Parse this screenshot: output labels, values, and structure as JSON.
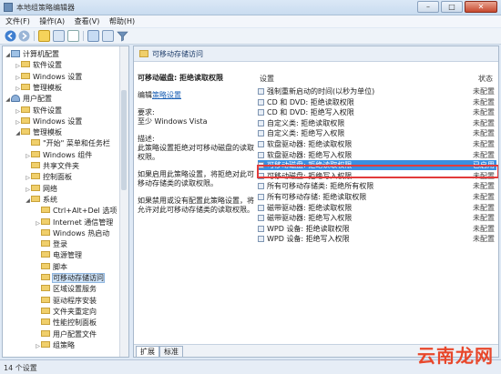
{
  "window": {
    "title": "本地组策略编辑器",
    "buttons": {
      "minimize": "–",
      "maximize": "□",
      "close": "✕"
    }
  },
  "menu": [
    "文件(F)",
    "操作(A)",
    "查看(V)",
    "帮助(H)"
  ],
  "tree": [
    {
      "label": "计算机配置",
      "icon": "computer",
      "level": 0,
      "exp": "◢"
    },
    {
      "label": "软件设置",
      "icon": "folder",
      "level": 1,
      "exp": "▷"
    },
    {
      "label": "Windows 设置",
      "icon": "folder",
      "level": 1,
      "exp": "▷"
    },
    {
      "label": "管理模板",
      "icon": "folder",
      "level": 1,
      "exp": "▷"
    },
    {
      "label": "用户配置",
      "icon": "user",
      "level": 0,
      "exp": "◢"
    },
    {
      "label": "软件设置",
      "icon": "folder",
      "level": 1,
      "exp": "▷"
    },
    {
      "label": "Windows 设置",
      "icon": "folder",
      "level": 1,
      "exp": "▷"
    },
    {
      "label": "管理模板",
      "icon": "folder",
      "level": 1,
      "exp": "◢"
    },
    {
      "label": "\"开始\" 菜单和任务栏",
      "icon": "folder",
      "level": 2,
      "exp": ""
    },
    {
      "label": "Windows 组件",
      "icon": "folder",
      "level": 2,
      "exp": "▷"
    },
    {
      "label": "共享文件夹",
      "icon": "folder",
      "level": 2,
      "exp": ""
    },
    {
      "label": "控制面板",
      "icon": "folder",
      "level": 2,
      "exp": "▷"
    },
    {
      "label": "网络",
      "icon": "folder",
      "level": 2,
      "exp": "▷"
    },
    {
      "label": "系统",
      "icon": "folder",
      "level": 2,
      "exp": "◢"
    },
    {
      "label": "Ctrl+Alt+Del 选项",
      "icon": "folder",
      "level": 3,
      "exp": ""
    },
    {
      "label": "Internet 通信管理",
      "icon": "folder",
      "level": 3,
      "exp": "▷"
    },
    {
      "label": "Windows 热启动",
      "icon": "folder",
      "level": 3,
      "exp": ""
    },
    {
      "label": "登录",
      "icon": "folder",
      "level": 3,
      "exp": ""
    },
    {
      "label": "电源管理",
      "icon": "folder",
      "level": 3,
      "exp": ""
    },
    {
      "label": "脚本",
      "icon": "folder",
      "level": 3,
      "exp": ""
    },
    {
      "label": "可移动存储访问",
      "icon": "folder",
      "level": 3,
      "exp": "",
      "selected": true
    },
    {
      "label": "区域设置服务",
      "icon": "folder",
      "level": 3,
      "exp": ""
    },
    {
      "label": "驱动程序安装",
      "icon": "folder",
      "level": 3,
      "exp": ""
    },
    {
      "label": "文件夹重定向",
      "icon": "folder",
      "level": 3,
      "exp": ""
    },
    {
      "label": "性能控制面板",
      "icon": "folder",
      "level": 3,
      "exp": ""
    },
    {
      "label": "用户配置文件",
      "icon": "folder",
      "level": 3,
      "exp": ""
    },
    {
      "label": "组策略",
      "icon": "folder",
      "level": 3,
      "exp": "▷"
    }
  ],
  "pane": {
    "header": "可移动存储访问",
    "desc_title": "可移动磁盘: 拒绝读取权限",
    "edit_prefix": "编辑",
    "edit_link": "策略设置",
    "req_label": "要求:",
    "req_value": "至少 Windows Vista",
    "desc_label": "描述:",
    "desc_text": "此策略设置拒绝对可移动磁盘的读取权限。",
    "enabled_text": "如果启用此策略设置，将拒绝对此可移动存储类的读取权限。",
    "disabled_text": "如果禁用或没有配置此策略设置，将允许对此可移动存储类的读取权限。",
    "col_setting": "设置",
    "col_state": "状态",
    "rows": [
      {
        "name": "强制重新启动的时间(以秒为单位)",
        "state": "未配置"
      },
      {
        "name": "CD 和 DVD: 拒绝读取权限",
        "state": "未配置"
      },
      {
        "name": "CD 和 DVD: 拒绝写入权限",
        "state": "未配置"
      },
      {
        "name": "自定义类: 拒绝读取权限",
        "state": "未配置"
      },
      {
        "name": "自定义类: 拒绝写入权限",
        "state": "未配置"
      },
      {
        "name": "软盘驱动器: 拒绝读取权限",
        "state": "未配置"
      },
      {
        "name": "软盘驱动器: 拒绝写入权限",
        "state": "未配置"
      },
      {
        "name": "可移动磁盘: 拒绝读取权限",
        "state": "已启用",
        "selected": true
      },
      {
        "name": "可移动磁盘: 拒绝写入权限",
        "state": "未配置"
      },
      {
        "name": "所有可移动存储类: 拒绝所有权限",
        "state": "未配置"
      },
      {
        "name": "所有可移动存储: 拒绝读取权限",
        "state": "未配置"
      },
      {
        "name": "磁带驱动器: 拒绝读取权限",
        "state": "未配置"
      },
      {
        "name": "磁带驱动器: 拒绝写入权限",
        "state": "未配置"
      },
      {
        "name": "WPD 设备: 拒绝读取权限",
        "state": "未配置"
      },
      {
        "name": "WPD 设备: 拒绝写入权限",
        "state": "未配置"
      }
    ],
    "tabs": [
      "扩展",
      "标准"
    ]
  },
  "status": "14 个设置",
  "watermark": "云南龙网",
  "colors": {
    "selection": "#3b8fe0",
    "highlight_box": "#e23b3b",
    "link": "#1a5fb4"
  }
}
